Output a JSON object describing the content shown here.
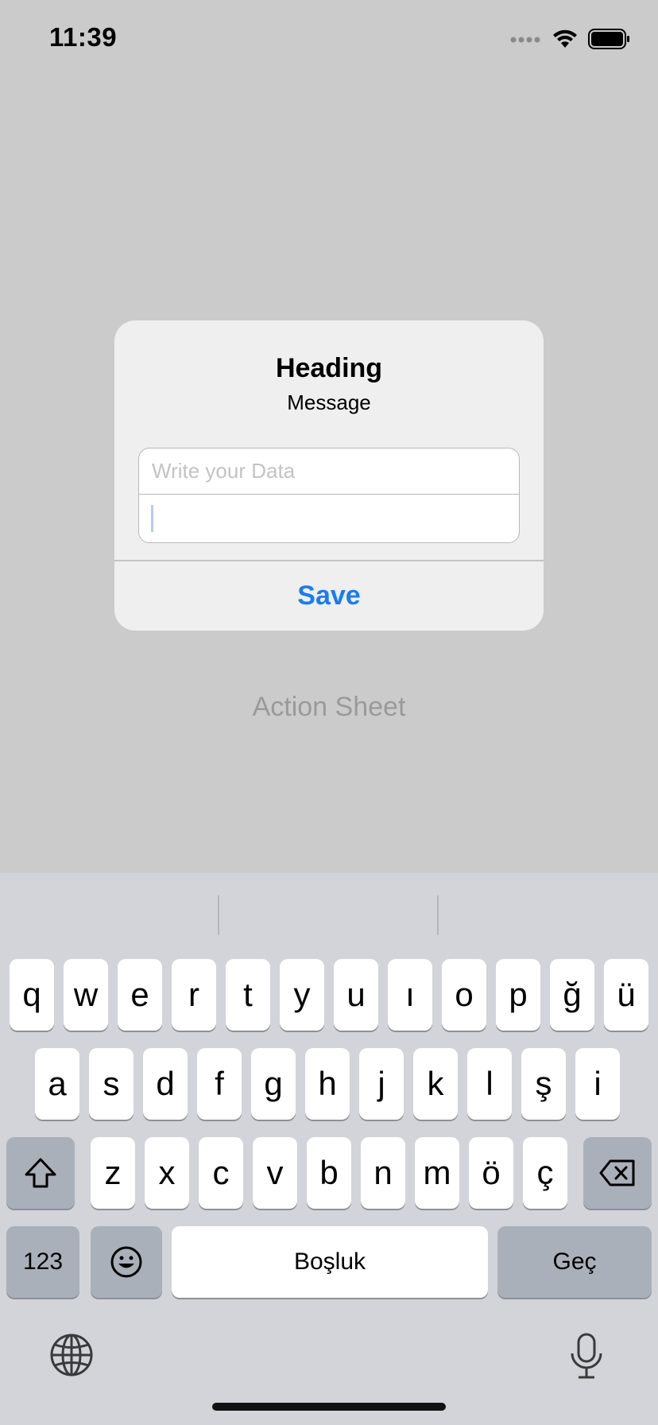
{
  "status": {
    "time": "11:39",
    "wifi_icon": "wifi-icon",
    "battery_icon": "battery-icon",
    "signal_icon": "cellular-dots-icon"
  },
  "background": {
    "button_label": "Action Sheet"
  },
  "alert": {
    "title": "Heading",
    "message": "Message",
    "field1_placeholder": "Write your Data",
    "field1_value": "",
    "field2_value": "",
    "save_label": "Save",
    "accent_color": "#1a7cf2"
  },
  "keyboard": {
    "row1": [
      "q",
      "w",
      "e",
      "r",
      "t",
      "y",
      "u",
      "ı",
      "o",
      "p",
      "ğ",
      "ü"
    ],
    "row2": [
      "a",
      "s",
      "d",
      "f",
      "g",
      "h",
      "j",
      "k",
      "l",
      "ş",
      "i"
    ],
    "row3": [
      "z",
      "x",
      "c",
      "v",
      "b",
      "n",
      "m",
      "ö",
      "ç"
    ],
    "numbers_label": "123",
    "space_label": "Boşluk",
    "return_label": "Geç",
    "shift_icon": "shift-icon",
    "delete_icon": "delete-icon",
    "emoji_icon": "emoji-icon",
    "globe_icon": "globe-icon",
    "mic_icon": "microphone-icon"
  }
}
